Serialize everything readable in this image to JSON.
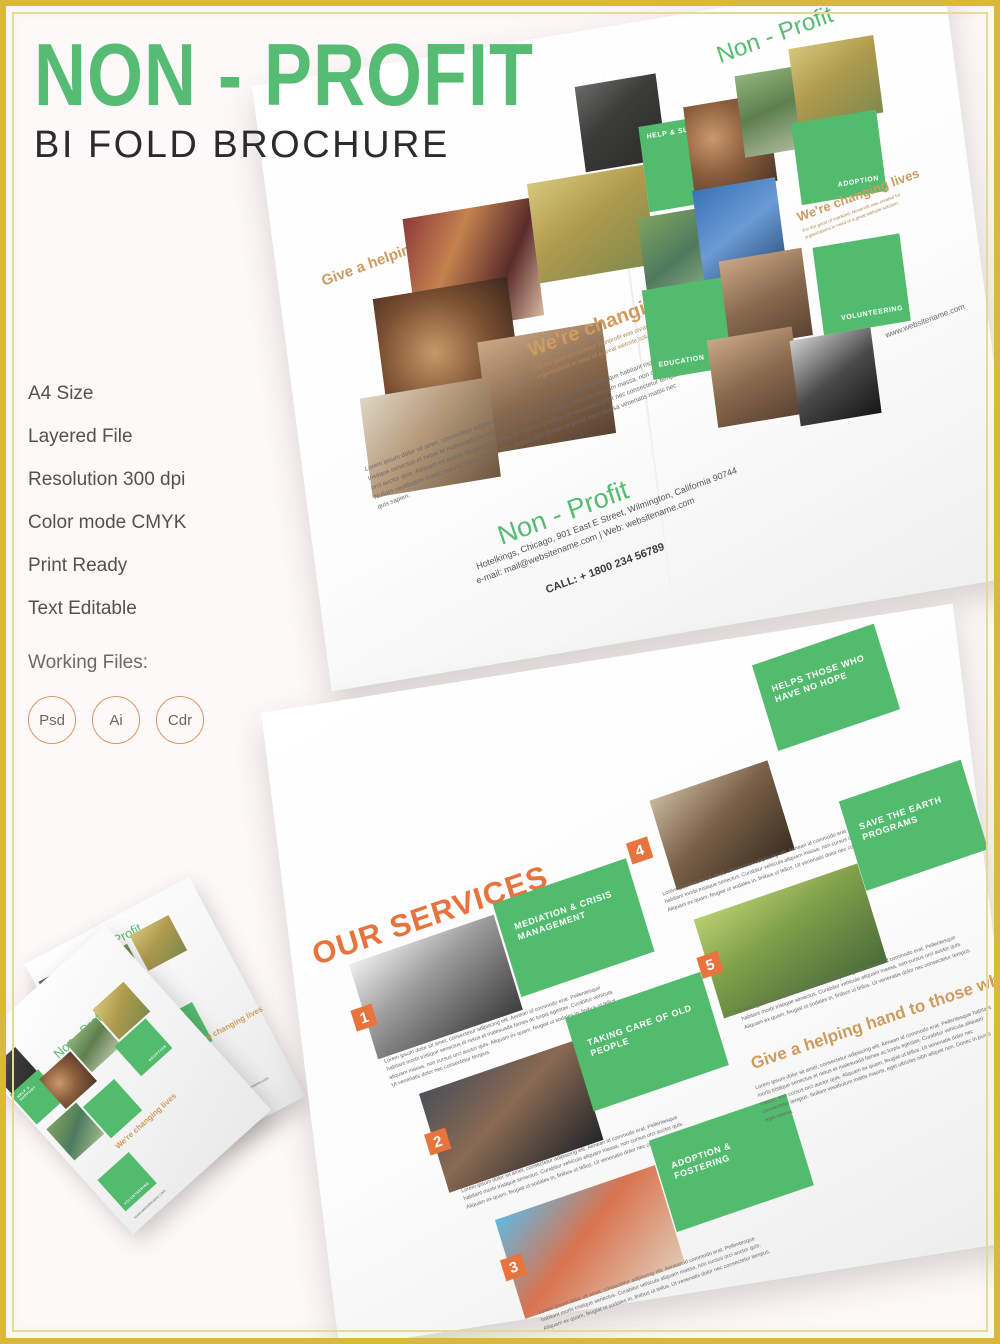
{
  "header": {
    "title_main": "NON - PROFIT",
    "title_sub": "BI FOLD BROCHURE"
  },
  "specs": {
    "items": [
      "A4 Size",
      "Layered File",
      "Resolution 300 dpi",
      "Color mode CMYK",
      "Print Ready",
      "Text Editable"
    ],
    "working_files_label": "Working Files:",
    "formats": [
      "Psd",
      "Ai",
      "Cdr"
    ]
  },
  "brochure_cover": {
    "brand": "Non - Profit",
    "tagline": "Give a helping hand to those who need it!",
    "heading": "We're changing lives",
    "heading_sub": "For the good of mankind. Nonprofit was created for organizations in need of a great website solution.",
    "body": "Lorem ipsum dolor sit amet, consectetur adipiscing elit. Aenean id commodo erat. Pellentesque habitant morbi tristique senectus et netus et malesuada fames ac turpis egestas. Curabitur vehicula aliquam massa, non cursus orci auctor quis. Aliquam ex quam, feugiat ut sodales in, finibus ut tellus. Ut venenatis dolor nec consectetur tempus. Nullam vestibulum mattis mauris, eget ultricies nibh aliquet non. Donec in purus eget massa venenatis mattis nec quis sapien.",
    "labels": [
      "Help & Support",
      "Adoption",
      "Education",
      "Volunteering"
    ],
    "website_side": "www.websitename.com",
    "contact": {
      "address": "Hotelkings, Chicago, 901 East E Street,  Wilmington, California 90744",
      "email_web": "e-mail: mail@websitename.com   |   Web: websitename.com",
      "phone": "CALL: + 1800 234 56789"
    }
  },
  "brochure_inside": {
    "heading": "OUR SERVICES",
    "tagline": "Give a helping hand to those who need it!",
    "tagline_body": "Lorem ipsum dolor sit amet, consectetur adipiscing elit. Aenean id commodo erat. Pellentesque habitant morbi tristique senectus et netus et malesuada fames ac turpis egestas. Curabitur vehicula aliquam massa, non cursus orci auctor quis. Aliquam ex quam, feugiat ut tellus. Ut venenatis dolor nec consectetur tempus. Nullam vestibulum mattis mauris, eget ultricies nibh aliquet non. Donec in purus eget massa.",
    "services": [
      {
        "number": "1",
        "title": "MEDIATION & CRISIS MANAGEMENT",
        "body": "Lorem ipsum dolor sit amet, consectetur adipiscing elit. Aenean id commodo erat. Pellentesque habitant morbi tristique senectus et netus et malesuada fames ac turpis egestas. Curabitur vehicula aliquam massa, non cursus orci auctor quis. Aliquam ex quam, feugiat ut sodales in, finibus ut tellus. Ut venenatis dolor nec consectetur tempus."
      },
      {
        "number": "2",
        "title": "TAKING CARE OF OLD PEOPLE",
        "body": "Lorem ipsum dolor sit amet, consectetur adipiscing elit. Aenean id commodo erat. Pellentesque habitant morbi tristique senectus. Curabitur vehicula aliquam massa, non cursus orci auctor quis. Aliquam ex quam, feugiat ut sodales in, finibus ut tellus. Ut venenatis dolor nec consectetur tempus."
      },
      {
        "number": "3",
        "title": "ADOPTION & FOSTERING",
        "body": "Lorem ipsum dolor sit amet, consectetur adipiscing elit. Aenean id commodo erat. Pellentesque habitant morbi tristique senectus. Curabitur vehicula aliquam massa, non cursus orci auctor quis. Aliquam ex quam, feugiat ut sodales in, finibus ut tellus. Ut venenatis dolor nec consectetur tempus."
      },
      {
        "number": "4",
        "title": "HELPS THOSE WHO HAVE NO HOPE",
        "body": "Lorem ipsum dolor sit amet, consectetur adipiscing elit. Aenean id commodo erat. Pellentesque habitant morbi tristique senectus. Curabitur vehicula aliquam massa, non cursus orci auctor quis. Aliquam ex quam, feugiat ut sodales in, finibus ut tellus. Ut venenatis dolor nec consectetur tempus."
      },
      {
        "number": "5",
        "title": "SAVE THE EARTH PROGRAMS",
        "body": "Lorem ipsum dolor sit amet, consectetur adipiscing elit. Aenean id commodo erat. Pellentesque habitant morbi tristique senectus. Curabitur vehicula aliquam massa, non cursus orci auctor quis. Aliquam ex quam, feugiat ut sodales in, finibus ut tellus. Ut venenatis dolor nec consectetur tempus."
      }
    ]
  },
  "thumbnail_stack": {
    "brand": "Non - Profit",
    "heading": "We're changing lives",
    "website": "www.websitename.com",
    "labels": [
      "Help & Support",
      "Adoption",
      "Education",
      "Volunteering"
    ]
  },
  "colors": {
    "green": "#52bb6e",
    "orange": "#e8733c",
    "gold_border": "#d9b83a",
    "tan_text": "#cf9b5e",
    "page_bg": "#fbf7f6"
  }
}
